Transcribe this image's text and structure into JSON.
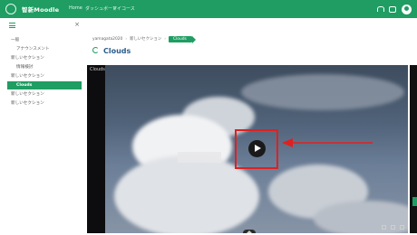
{
  "topbar": {
    "brand": "智新Moodle",
    "nav": [
      "Home",
      "ダッシュボード",
      "マイコース"
    ]
  },
  "sidebar": {
    "items": [
      {
        "label": "一般",
        "indent": false,
        "active": false
      },
      {
        "label": "アナウンスメント",
        "indent": true,
        "active": false
      },
      {
        "label": "新しいセクション",
        "indent": false,
        "active": false
      },
      {
        "label": "情報検討",
        "indent": true,
        "active": false
      },
      {
        "label": "新しいセクション",
        "indent": false,
        "active": false
      },
      {
        "label": "Clouds",
        "indent": true,
        "active": true
      },
      {
        "label": "新しいセクション",
        "indent": false,
        "active": false
      },
      {
        "label": "新しいセクション",
        "indent": false,
        "active": false
      }
    ]
  },
  "breadcrumb": {
    "items": [
      "yamagata2020",
      "新しいセクション",
      "Clouds"
    ]
  },
  "page": {
    "title": "Clouds"
  },
  "video": {
    "title": "Clouds"
  },
  "colors": {
    "brand_green": "#1f9d62",
    "title_blue": "#2a5d8a",
    "highlight_red": "#e02020"
  },
  "icons": [
    "logo-icon",
    "bell-icon",
    "chat-icon",
    "avatar",
    "recycle-icon",
    "play-icon",
    "arrow-icon"
  ]
}
